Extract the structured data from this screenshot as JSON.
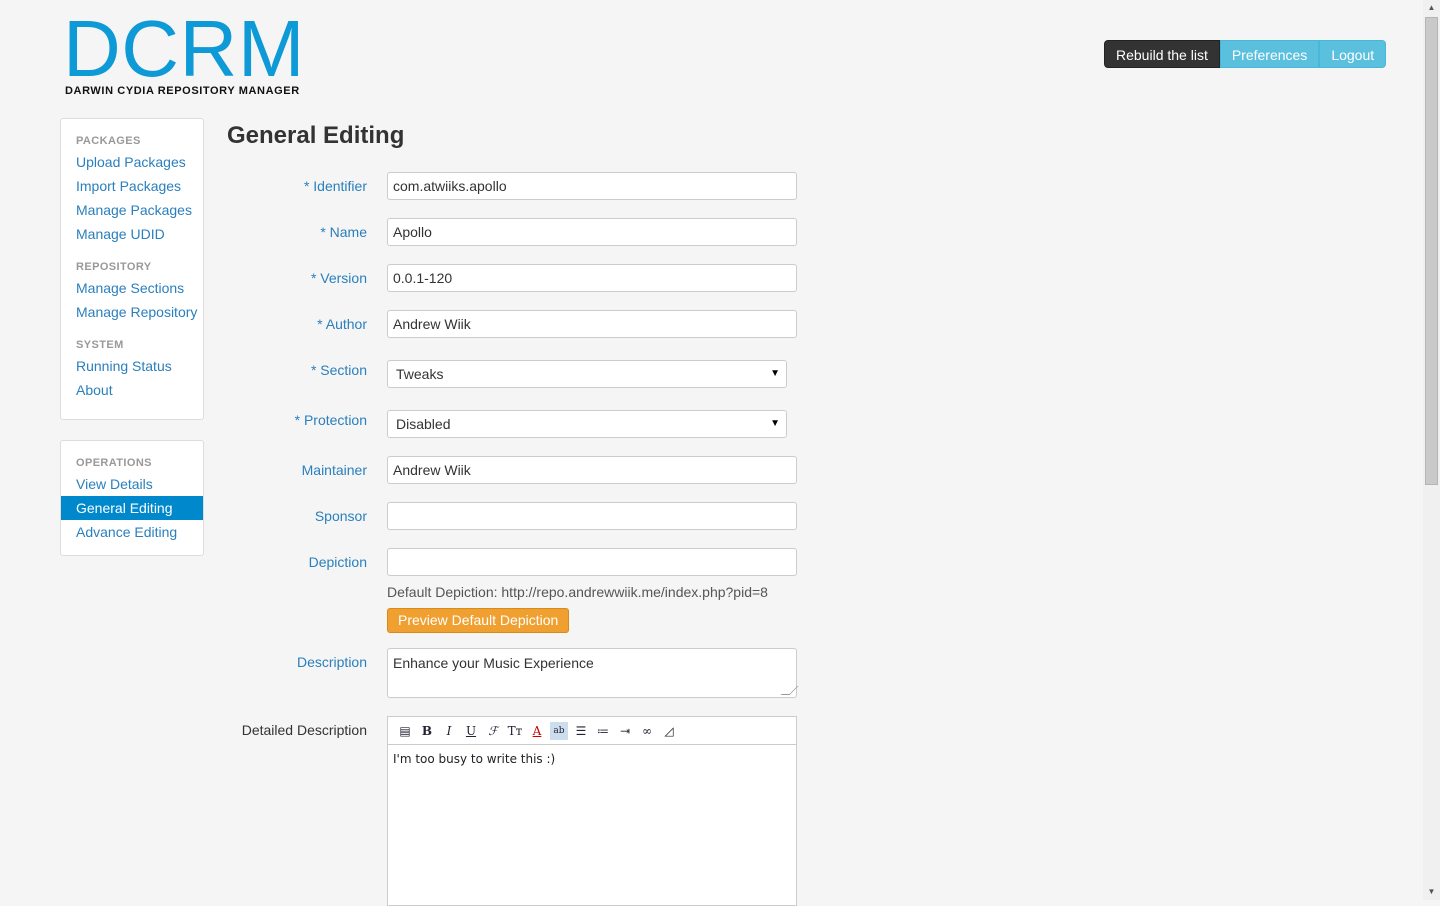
{
  "logo": {
    "text": "DCRM",
    "subtitle": "DARWIN CYDIA REPOSITORY MANAGER"
  },
  "header_buttons": [
    "Rebuild the list",
    "Preferences",
    "Logout"
  ],
  "sidebar": {
    "sections": [
      {
        "header": "PACKAGES",
        "items": [
          "Upload Packages",
          "Import Packages",
          "Manage Packages",
          "Manage UDID"
        ]
      },
      {
        "header": "REPOSITORY",
        "items": [
          "Manage Sections",
          "Manage Repository"
        ]
      },
      {
        "header": "SYSTEM",
        "items": [
          "Running Status",
          "About"
        ]
      }
    ],
    "operations": {
      "header": "OPERATIONS",
      "items": [
        "View Details",
        "General Editing",
        "Advance Editing"
      ],
      "active": "General Editing"
    }
  },
  "form": {
    "title": "General Editing",
    "fields": {
      "identifier": {
        "label": "* Identifier",
        "value": "com.atwiiks.apollo"
      },
      "name": {
        "label": "* Name",
        "value": "Apollo"
      },
      "version": {
        "label": "* Version",
        "value": "0.0.1-120"
      },
      "author": {
        "label": "* Author",
        "value": "Andrew Wiik"
      },
      "section": {
        "label": "* Section",
        "value": "Tweaks"
      },
      "protection": {
        "label": "* Protection",
        "value": "Disabled"
      },
      "maintainer": {
        "label": "Maintainer",
        "value": "Andrew Wiik"
      },
      "sponsor": {
        "label": "Sponsor",
        "value": ""
      },
      "depiction": {
        "label": "Depiction",
        "value": ""
      },
      "description": {
        "label": "Description",
        "value": "Enhance your Music Experience"
      },
      "detailed_description": {
        "label": "Detailed Description",
        "value": "I'm too busy to write this :)"
      }
    },
    "default_depiction_text": "Default Depiction: http://repo.andrewwiik.me/index.php?pid=8",
    "preview_button": "Preview Default Depiction"
  },
  "editor_toolbar": [
    "source-icon",
    "bold-icon",
    "italic-icon",
    "underline-icon",
    "font-icon",
    "font-size-icon",
    "text-color-icon",
    "highlight-icon",
    "align-icon",
    "list-icon",
    "indent-icon",
    "link-icon",
    "eraser-icon"
  ],
  "colors": {
    "link": "#2a7fbd",
    "active": "#0088cc",
    "logo": "#0e9ad6",
    "warning": "#f0a030",
    "info": "#5bc0de"
  }
}
